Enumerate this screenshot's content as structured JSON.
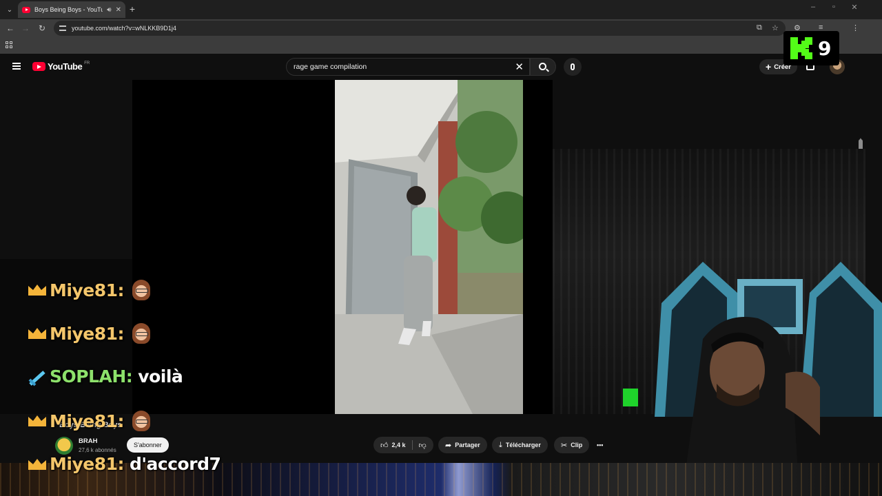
{
  "browser": {
    "tab_title": "Boys Being Boys - YouTube",
    "url": "youtube.com/watch?v=wNLKKB9D1j4",
    "new_tab_label": "+",
    "tab_dropdown": "⌄",
    "window_minimize": "–",
    "window_restore": "▫",
    "window_close": "✕"
  },
  "youtube": {
    "logo_text": "YouTube",
    "region": "FR",
    "search_value": "rage game compilation",
    "create_label": "Créer"
  },
  "video": {
    "title": "Boys Being Boys",
    "channel_name": "BRAH",
    "subscribers": "27,6 k abonnés",
    "subscribe_label": "S'abonner",
    "likes": "2,4 k",
    "share_label": "Partager",
    "download_label": "Télécharger",
    "clip_label": "Clip",
    "more_label": "•••"
  },
  "chat": [
    {
      "user": "Miye81:",
      "badge": "crown",
      "message": "",
      "emote": true,
      "color": "#f4c66b"
    },
    {
      "user": "Miye81:",
      "badge": "crown",
      "message": "",
      "emote": true,
      "color": "#f4c66b"
    },
    {
      "user": "SOPLAH:",
      "badge": "sword",
      "message": "voilà",
      "emote": false,
      "color": "#8de16b"
    },
    {
      "user": "Miye81:",
      "badge": "crown",
      "message": "",
      "emote": true,
      "color": "#f4c66b"
    },
    {
      "user": "Miye81:",
      "badge": "crown",
      "message": "d'accord7",
      "emote": false,
      "color": "#f4c66b"
    }
  ],
  "overlay": {
    "viewer_count": "9",
    "platform_icon": "kick-logo-icon",
    "brand_color": "#53fc18"
  },
  "colors": {
    "youtube_red": "#ff0033",
    "chat_gold": "#f4c66b",
    "chat_green": "#8de16b"
  }
}
